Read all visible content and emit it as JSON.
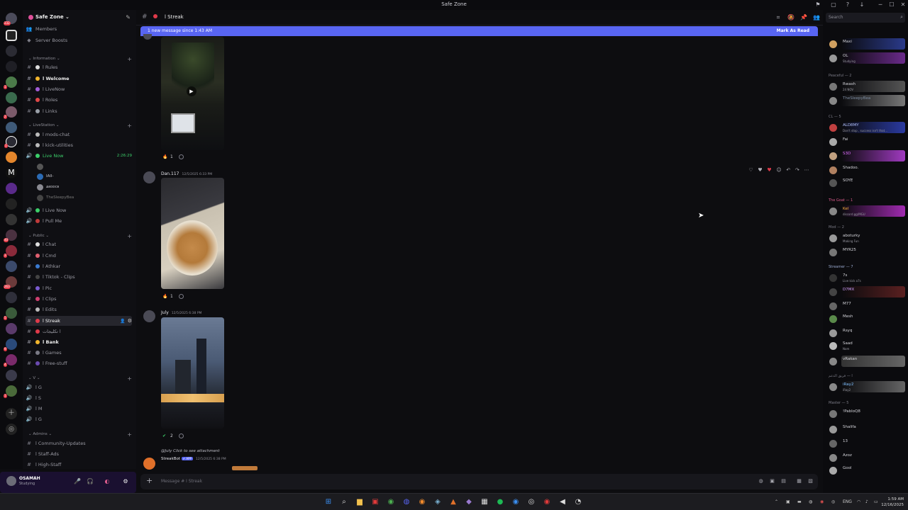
{
  "window": {
    "title": "Safe Zone",
    "controls": [
      "─",
      "☐",
      "✕"
    ]
  },
  "guilds": {
    "badges": [
      "232",
      "1",
      "2",
      "1",
      "40",
      "3",
      "263",
      "5",
      "9",
      "4",
      "1"
    ]
  },
  "server": {
    "name": "Safe Zone ⌄",
    "top_items": [
      "Members",
      "Server Boosts"
    ],
    "categories": {
      "information": "⌄ Information ⌄",
      "livestation": "⌄ LiveStation ⌄",
      "public": "⌄ Public ⌄",
      "v": "⌄ V ⌄",
      "admins": "⌄ Admins ⌄"
    },
    "channels": {
      "rules": "ا Rules",
      "welcome": "ا Welcome",
      "livenow1": "ا LiveNow",
      "roles": "ا Roles",
      "links": "ا Links",
      "mods_chat": "ا mods-chat",
      "kick_utilities": "ا kick-utilities",
      "live_now_voice": "Live Now",
      "live_now_timer": "2:26:29",
      "live_now_2": "ا Live Now",
      "pull_me": "ا Pull Me",
      "chat": "ا Chat",
      "cmd": "ا Cmd",
      "athkar": "ا Athkar",
      "tiktok": "ا Tiktok - Clips",
      "pic": "ا Pic",
      "clips": "ا Clips",
      "edits": "ا Edits",
      "streak": "ا Streak",
      "arabic": "ا تكليجات",
      "bank": "ا Bank",
      "games": "ا Games",
      "free_stuff": "ا Free-stuff",
      "v_g": "ا G",
      "v_s": "ا S",
      "v_m": "ا M",
      "v_g2": "ا G",
      "community_updates": "ا Community-Updates",
      "staff_ads": "ا Staff-Ads",
      "high_staff": "ا High-Staff"
    },
    "voice_users": [
      "IAll-",
      "ᴀᴇᴅᴅᴄᴇ",
      "TheSleepyBea"
    ]
  },
  "user_panel": {
    "name": "OSAMAH",
    "status": "Studying"
  },
  "chat": {
    "channel_name": "ا Streak",
    "new_messages": "1 new message since 1:43 AM",
    "mark_as_read": "Mark As Read",
    "messages": [
      {
        "author": "",
        "time": "",
        "reaction_count": "1"
      },
      {
        "author": "Dan.117",
        "time": "12/5/2025 6:33 PM",
        "reaction_count": "1"
      },
      {
        "author": "July",
        "time": "12/5/2025 6:38 PM",
        "reaction_count": "2"
      }
    ],
    "reply_preview": "@July Click to see attachment",
    "bot": {
      "name": "StreakBot",
      "tag": "✔ APP",
      "time": "12/5/2025 6:38 PM"
    },
    "composer_placeholder": "Message # ا Streak"
  },
  "members": {
    "search_placeholder": "Search",
    "categories": {
      "peaceful": "Peaceful — 2",
      "cl": "CL — 5",
      "the_goat": "The Goat — 1",
      "mod": "Mod — 2",
      "streamer": "Streamer — 7",
      "arabic": "ا — فريق الدعم",
      "master": "Master — 5"
    },
    "list": [
      {
        "name": "Maxi",
        "status": ""
      },
      {
        "name": "OL",
        "status": "Studying"
      },
      {
        "name": "Rwash",
        "status": "24 NOV"
      },
      {
        "name": "TheSleepyBea",
        "status": ""
      },
      {
        "name": "ALD8MY",
        "status": "Don't stop , success isn't that..."
      },
      {
        "name": "Fai",
        "status": ""
      },
      {
        "name": "S3D",
        "status": ""
      },
      {
        "name": "Shadoo.",
        "status": ""
      },
      {
        "name": "SOYE",
        "status": ""
      },
      {
        "name": "Kel",
        "status": "discord.gg/MGU"
      },
      {
        "name": "aboturky",
        "status": "Making Fun"
      },
      {
        "name": "MYR25",
        "status": ""
      },
      {
        "name": "7s",
        "status": "Live kick a7s"
      },
      {
        "name": "D7MX",
        "status": ""
      },
      {
        "name": "M77",
        "status": ""
      },
      {
        "name": "Mesh",
        "status": ""
      },
      {
        "name": "Rsyq",
        "status": ""
      },
      {
        "name": "Saad",
        "status": "Nom"
      },
      {
        "name": "vRakan",
        "status": ""
      },
      {
        "name": "iRay2",
        "status": "iRay2"
      },
      {
        "name": "!PabloQ8",
        "status": ""
      },
      {
        "name": "Shalifa",
        "status": ""
      },
      {
        "name": "13",
        "status": ""
      },
      {
        "name": "Azoz",
        "status": ""
      },
      {
        "name": "Gool",
        "status": ""
      }
    ]
  },
  "taskbar": {
    "lang": "ENG",
    "time": "1:59 AM",
    "date": "12/16/2025"
  }
}
